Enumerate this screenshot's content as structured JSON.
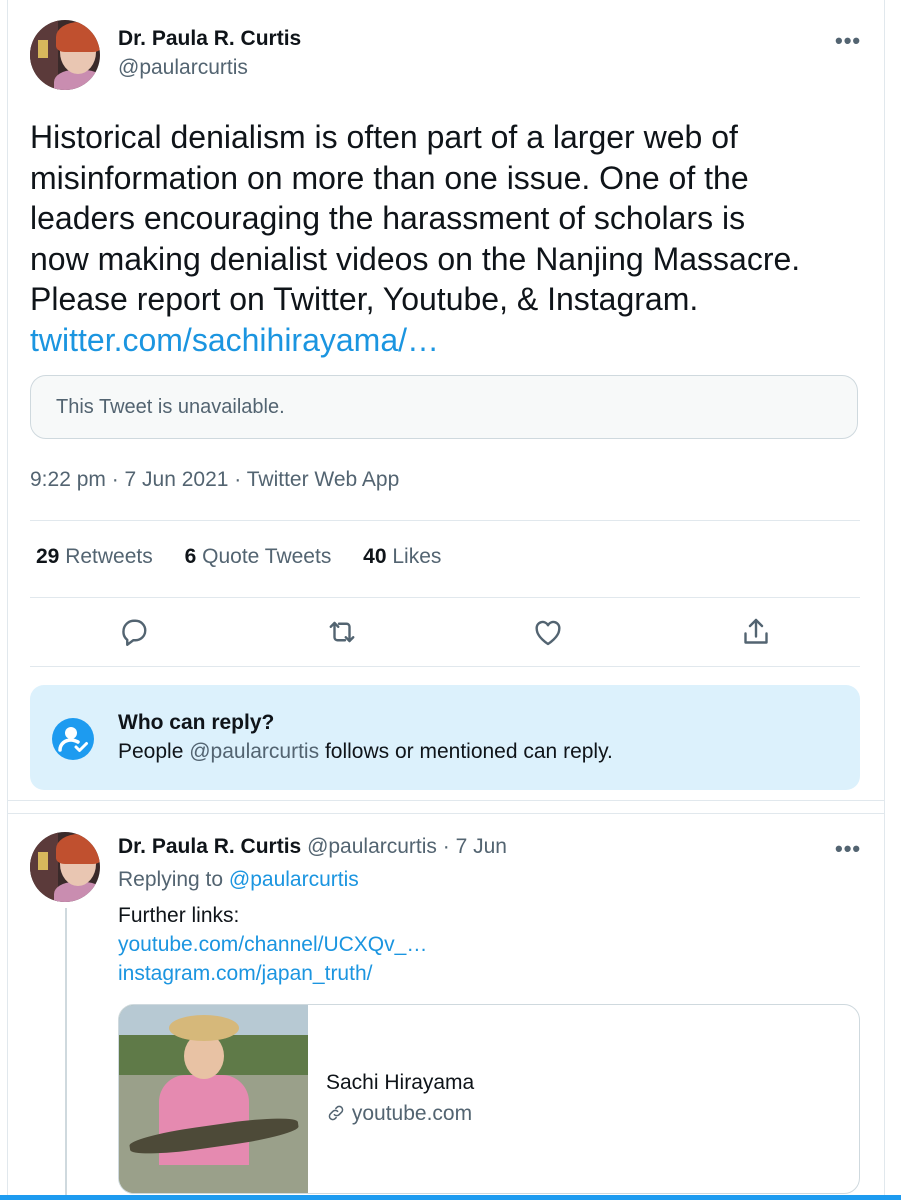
{
  "main_tweet": {
    "author_name": "Dr. Paula R. Curtis",
    "author_handle": "@paularcurtis",
    "more_icon": "more-horizontal-icon",
    "text_lines": [
      "Historical denialism is often part of a larger web of",
      "misinformation on more than one issue. One of the",
      "leaders encouraging the harassment of scholars is",
      "now making denialist videos on the Nanjing Massacre.",
      "Please report on Twitter, Youtube, & Instagram."
    ],
    "link": "twitter.com/sachihirayama/…",
    "quoted_unavailable": "This Tweet is unavailable.",
    "meta": "9:22 pm · 7 Jun 2021 · Twitter Web App"
  },
  "stats": {
    "retweets_count": "29",
    "retweets_label": "Retweets",
    "quotes_count": "6",
    "quotes_label": "Quote Tweets",
    "likes_count": "40",
    "likes_label": "Likes"
  },
  "actions": [
    "reply-icon",
    "retweet-icon",
    "like-icon",
    "share-icon"
  ],
  "who_can_reply": {
    "title": "Who can reply?",
    "desc_before": "People ",
    "desc_mention": "@paularcurtis",
    "desc_after": " follows or mentioned can reply."
  },
  "reply_tweet": {
    "author_name": "Dr. Paula R. Curtis",
    "author_handle": "@paularcurtis",
    "time": "· 7 Jun",
    "replying_prefix": "Replying to ",
    "replying_mention": "@paularcurtis",
    "text": "Further links:",
    "links": [
      "youtube.com/channel/UCXQv_…",
      "instagram.com/japan_truth/"
    ],
    "card": {
      "title": "Sachi Hirayama",
      "domain": "youtube.com",
      "link_icon": "link-icon"
    }
  },
  "colors": {
    "link": "#1b95e0",
    "muted": "#536471",
    "reply_box_bg": "#dcf1fc",
    "accent": "#1d9bf0"
  }
}
